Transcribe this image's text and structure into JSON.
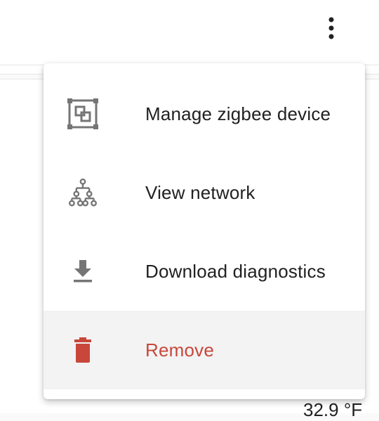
{
  "header": {
    "overflow_icon": "dots-vertical-icon"
  },
  "menu": {
    "items": [
      {
        "label": "Manage zigbee device",
        "icon": "zigbee-icon"
      },
      {
        "label": "View network",
        "icon": "network-tree-icon"
      },
      {
        "label": "Download diagnostics",
        "icon": "download-icon"
      },
      {
        "label": "Remove",
        "icon": "delete-icon"
      }
    ]
  },
  "background": {
    "temperature": "32.9 °F"
  },
  "colors": {
    "icon": "#757575",
    "danger": "#c8473a",
    "text": "#212121",
    "hover_bg": "#f3f3f3"
  }
}
